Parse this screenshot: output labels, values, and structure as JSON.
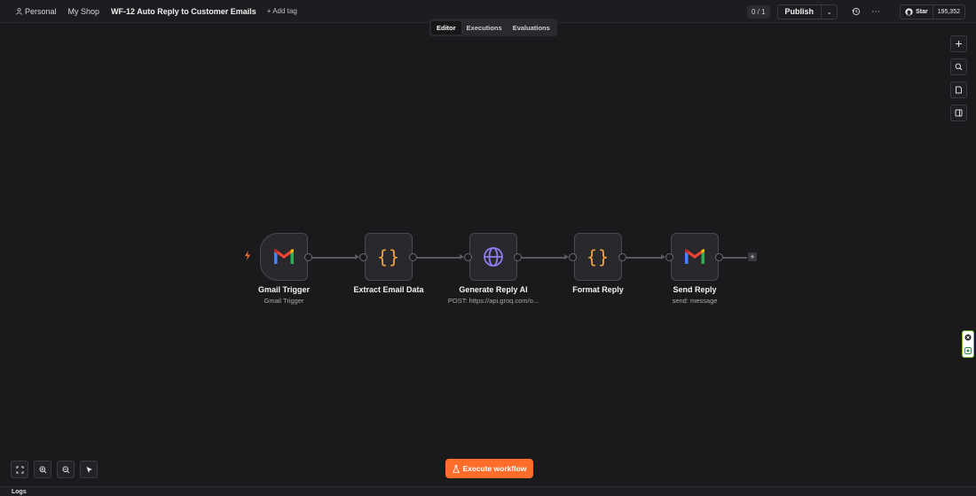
{
  "header": {
    "project": "Personal",
    "folder": "My Shop",
    "separator": "",
    "workflow_name": "WF-12 Auto Reply to Customer Emails",
    "add_tag": "+ Add tag",
    "counter": "0 / 1",
    "publish_label": "Publish",
    "github_label": "Star",
    "github_count": "195,352"
  },
  "tabs": [
    "Editor",
    "Executions",
    "Evaluations"
  ],
  "active_tab": "Editor",
  "nodes": [
    {
      "title": "Gmail Trigger",
      "subtitle": "Gmail Trigger",
      "icon": "gmail-icon"
    },
    {
      "title": "Extract Email Data",
      "subtitle": "",
      "icon": "code-braces-icon"
    },
    {
      "title": "Generate Reply AI",
      "subtitle": "POST: https://api.groq.com/o...",
      "icon": "globe-icon"
    },
    {
      "title": "Format Reply",
      "subtitle": "",
      "icon": "code-braces-icon"
    },
    {
      "title": "Send Reply",
      "subtitle": "send: message",
      "icon": "gmail-icon"
    }
  ],
  "execute_label": "Execute workflow",
  "logs_label": "Logs",
  "colors": {
    "accent": "#ff6d2b",
    "canvas": "#1a191c",
    "braces": "#f1a340",
    "globe": "#8f7cf0"
  }
}
